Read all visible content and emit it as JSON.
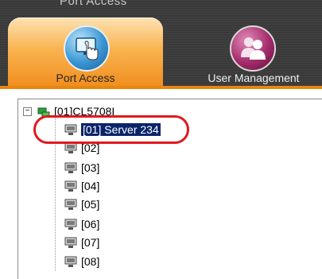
{
  "breadcrumb": "Port Access",
  "tabs": [
    {
      "label": "Port Access",
      "active": true,
      "icon": "port-access-icon"
    },
    {
      "label": "User Management",
      "active": false,
      "icon": "user-management-icon"
    }
  ],
  "tree": {
    "root": {
      "label": "[01]CL5708I",
      "expanded": true,
      "icon": "kvm-switch-icon"
    },
    "ports": [
      {
        "label": "[01] Server 234",
        "selected": true
      },
      {
        "label": "[02]"
      },
      {
        "label": "[03]"
      },
      {
        "label": "[04]"
      },
      {
        "label": "[05]"
      },
      {
        "label": "[06]"
      },
      {
        "label": "[07]"
      },
      {
        "label": "[08]"
      }
    ]
  },
  "colors": {
    "accent": "#f08c1c",
    "selection": "#0a246a",
    "highlight_ring": "#e0191e"
  }
}
